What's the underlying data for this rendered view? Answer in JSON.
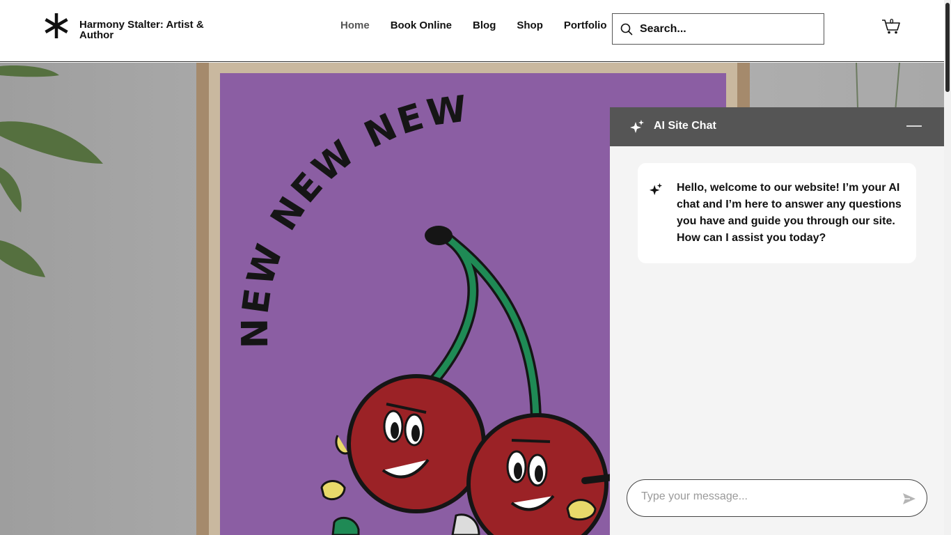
{
  "header": {
    "site_title": "Harmony Stalter: Artist & Author",
    "logo_icon": "asterisk-logo-icon",
    "nav": [
      {
        "label": "Home",
        "active": true
      },
      {
        "label": "Book Online",
        "active": false
      },
      {
        "label": "Blog",
        "active": false
      },
      {
        "label": "Shop",
        "active": false
      },
      {
        "label": "Portfolio",
        "active": false
      }
    ],
    "search": {
      "placeholder": "Search...",
      "icon": "search-icon"
    },
    "cart": {
      "icon": "cart-icon",
      "count": "0"
    }
  },
  "hero": {
    "image": "framed-cherries-poster",
    "poster_text": "NEW NEW NEW",
    "poster_background": "#8b5ea3",
    "cherry_color": "#9b2226",
    "stem_color": "#1f8a55",
    "frame_color": "#a58a6c"
  },
  "chat": {
    "title": "AI Site Chat",
    "header_icon": "sparkle-icon",
    "minimize_icon": "minimize-icon",
    "message": "Hello, welcome to our website! I’m your AI chat and I’m here to answer any questions you have and guide you through our site. How can I assist you today?",
    "message_icon": "sparkle-icon",
    "input_placeholder": "Type your message...",
    "send_icon": "send-icon",
    "header_color": "#555555",
    "panel_color": "#f4f4f4"
  }
}
